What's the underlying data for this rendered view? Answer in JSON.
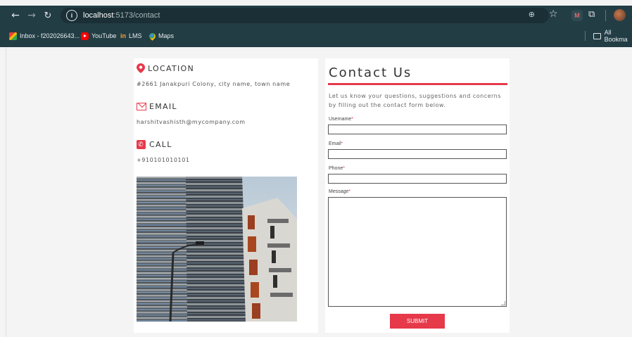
{
  "browser": {
    "url_host": "localhost",
    "url_path": ":5173/contact",
    "bookmarks": [
      {
        "label": "Inbox - f202026643...",
        "icon": "gmail-icon"
      },
      {
        "label": "YouTube",
        "icon": "youtube-icon"
      },
      {
        "label": "LMS",
        "icon": "lms-icon"
      },
      {
        "label": "Maps",
        "icon": "maps-icon"
      }
    ],
    "all_bookmarks": "All Bookma",
    "extension_m": "M",
    "lms_glyph": "in"
  },
  "contact_info": {
    "location": {
      "heading": "LOCATION",
      "text": "#2661 Janakpuri Colony, city name, town name",
      "icon": "location-pin-icon"
    },
    "email": {
      "heading": "EMAIL",
      "text": "harshitvashisth@mycompany.com",
      "icon": "mail-icon"
    },
    "call": {
      "heading": "CALL",
      "text": "+910101010101",
      "icon": "phone-icon"
    },
    "image": "building-photo"
  },
  "form": {
    "title": "Contact Us",
    "intro": "Let us know your questions, suggestions and concerns by filling out the contact form below.",
    "fields": [
      {
        "label": "Username",
        "required": "*"
      },
      {
        "label": "Email",
        "required": "*"
      },
      {
        "label": "Phone",
        "required": "*"
      },
      {
        "label": "Message",
        "required": "*"
      }
    ],
    "submit_label": "SUBMIT"
  },
  "colors": {
    "accent": "#e6394a",
    "chrome": "#233d45"
  }
}
